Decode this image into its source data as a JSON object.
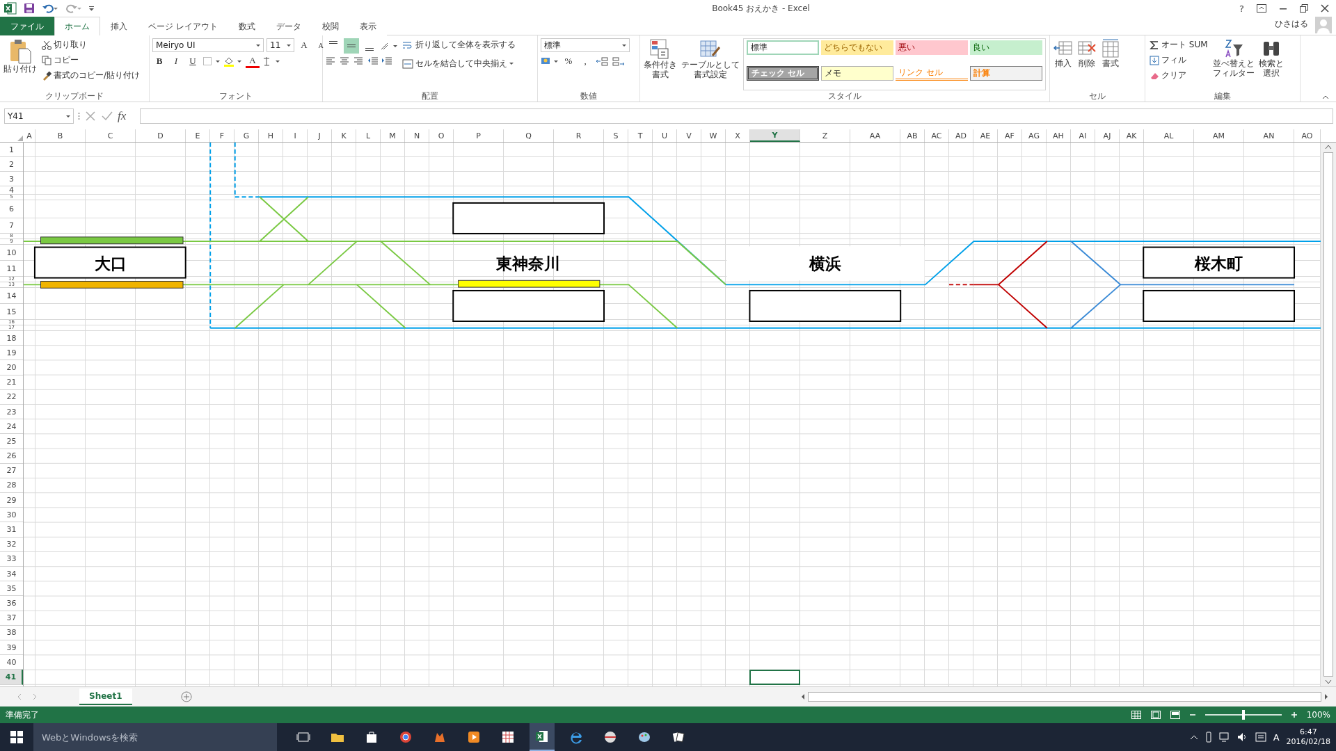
{
  "window": {
    "title": "Book45 おえかき - Excel",
    "help": "?",
    "user": "ひさはる"
  },
  "tabs": [
    {
      "label": "ファイル",
      "kind": "file",
      "selected": false
    },
    {
      "label": "ホーム",
      "kind": "tab",
      "selected": true
    },
    {
      "label": "挿入",
      "kind": "tab",
      "selected": false
    },
    {
      "label": "ページ レイアウト",
      "kind": "tab",
      "selected": false
    },
    {
      "label": "数式",
      "kind": "tab",
      "selected": false
    },
    {
      "label": "データ",
      "kind": "tab",
      "selected": false
    },
    {
      "label": "校閲",
      "kind": "tab",
      "selected": false
    },
    {
      "label": "表示",
      "kind": "tab",
      "selected": false
    }
  ],
  "clipboard": {
    "paste": "貼り付け",
    "cut": "切り取り",
    "copy": "コピー",
    "format_painter": "書式のコピー/貼り付け",
    "label": "クリップボード"
  },
  "font": {
    "name": "Meiryo UI",
    "size": "11",
    "grow": "A",
    "shrink": "A",
    "bold": "B",
    "italic": "I",
    "underline": "U",
    "font_color": "A",
    "label": "フォント"
  },
  "alignment": {
    "vertical": [
      {
        "selected": false
      },
      {
        "selected": true
      },
      {
        "selected": false
      }
    ],
    "wrap": "折り返して全体を表示する",
    "merge": "セルを結合して中央揃え",
    "label": "配置"
  },
  "number": {
    "format": "標準",
    "percent": "%",
    "comma": ",",
    "label": "数値"
  },
  "styles": {
    "conditional": [
      "条件付き",
      "書式"
    ],
    "table": [
      "テーブルとして",
      "書式設定"
    ],
    "cells": [
      {
        "label": "標準",
        "kind": "normal"
      },
      {
        "label": "どちらでもない",
        "kind": "neutral"
      },
      {
        "label": "悪い",
        "kind": "bad"
      },
      {
        "label": "良い",
        "kind": "good"
      },
      {
        "label": "チェック セル",
        "kind": "check"
      },
      {
        "label": "メモ",
        "kind": "note"
      },
      {
        "label": "リンク セル",
        "kind": "link"
      },
      {
        "label": "計算",
        "kind": "calc"
      }
    ],
    "label": "スタイル"
  },
  "cells": {
    "insert": "挿入",
    "delete": "削除",
    "format": "書式",
    "label": "セル"
  },
  "editing": {
    "autosum": "オート SUM",
    "fill": "フィル",
    "clear": "クリア",
    "sort": [
      "並べ替えと",
      "フィルター"
    ],
    "find": [
      "検索と",
      "選択"
    ],
    "label": "編集"
  },
  "formula_bar": {
    "name_box": "Y41",
    "fx": "fx"
  },
  "columns": [
    {
      "label": "A",
      "selected": false
    },
    {
      "label": "B",
      "selected": false
    },
    {
      "label": "C",
      "selected": false
    },
    {
      "label": "D",
      "selected": false
    },
    {
      "label": "E",
      "selected": false
    },
    {
      "label": "F",
      "selected": false
    },
    {
      "label": "G",
      "selected": false
    },
    {
      "label": "H",
      "selected": false
    },
    {
      "label": "I",
      "selected": false
    },
    {
      "label": "J",
      "selected": false
    },
    {
      "label": "K",
      "selected": false
    },
    {
      "label": "L",
      "selected": false
    },
    {
      "label": "M",
      "selected": false
    },
    {
      "label": "N",
      "selected": false
    },
    {
      "label": "O",
      "selected": false
    },
    {
      "label": "P",
      "selected": false
    },
    {
      "label": "Q",
      "selected": false
    },
    {
      "label": "R",
      "selected": false
    },
    {
      "label": "S",
      "selected": false
    },
    {
      "label": "T",
      "selected": false
    },
    {
      "label": "U",
      "selected": false
    },
    {
      "label": "V",
      "selected": false
    },
    {
      "label": "W",
      "selected": false
    },
    {
      "label": "X",
      "selected": false
    },
    {
      "label": "Y",
      "selected": true
    },
    {
      "label": "Z",
      "selected": false
    },
    {
      "label": "AA",
      "selected": false
    },
    {
      "label": "AB",
      "selected": false
    },
    {
      "label": "AC",
      "selected": false
    },
    {
      "label": "AD",
      "selected": false
    },
    {
      "label": "AE",
      "selected": false
    },
    {
      "label": "AF",
      "selected": false
    },
    {
      "label": "AG",
      "selected": false
    },
    {
      "label": "AH",
      "selected": false
    },
    {
      "label": "AI",
      "selected": false
    },
    {
      "label": "AJ",
      "selected": false
    },
    {
      "label": "AK",
      "selected": false
    },
    {
      "label": "AL",
      "selected": false
    },
    {
      "label": "AM",
      "selected": false
    },
    {
      "label": "AN",
      "selected": false
    },
    {
      "label": "AO",
      "selected": false
    }
  ],
  "rows": [
    {
      "label": "1",
      "selected": false
    },
    {
      "label": "2",
      "selected": false
    },
    {
      "label": "3",
      "selected": false
    },
    {
      "label": "4",
      "selected": false
    },
    {
      "label": "5",
      "selected": false
    },
    {
      "label": "6",
      "selected": false
    },
    {
      "label": "7",
      "selected": false
    },
    {
      "label": "8",
      "selected": false
    },
    {
      "label": "9",
      "selected": false
    },
    {
      "label": "10",
      "selected": false
    },
    {
      "label": "11",
      "selected": false
    },
    {
      "label": "12",
      "selected": false
    },
    {
      "label": "13",
      "selected": false
    },
    {
      "label": "14",
      "selected": false
    },
    {
      "label": "15",
      "selected": false
    },
    {
      "label": "16",
      "selected": false
    },
    {
      "label": "17",
      "selected": false
    },
    {
      "label": "18",
      "selected": false
    },
    {
      "label": "19",
      "selected": false
    },
    {
      "label": "20",
      "selected": false
    },
    {
      "label": "21",
      "selected": false
    },
    {
      "label": "22",
      "selected": false
    },
    {
      "label": "23",
      "selected": false
    },
    {
      "label": "24",
      "selected": false
    },
    {
      "label": "25",
      "selected": false
    },
    {
      "label": "26",
      "selected": false
    },
    {
      "label": "27",
      "selected": false
    },
    {
      "label": "28",
      "selected": false
    },
    {
      "label": "29",
      "selected": false
    },
    {
      "label": "30",
      "selected": false
    },
    {
      "label": "31",
      "selected": false
    },
    {
      "label": "32",
      "selected": false
    },
    {
      "label": "33",
      "selected": false
    },
    {
      "label": "34",
      "selected": false
    },
    {
      "label": "35",
      "selected": false
    },
    {
      "label": "36",
      "selected": false
    },
    {
      "label": "37",
      "selected": false
    },
    {
      "label": "38",
      "selected": false
    },
    {
      "label": "39",
      "selected": false
    },
    {
      "label": "40",
      "selected": false
    },
    {
      "label": "41",
      "selected": true
    }
  ],
  "stations": [
    {
      "name": "大口"
    },
    {
      "name": "東神奈川"
    },
    {
      "name": "横浜"
    },
    {
      "name": "桜木町"
    }
  ],
  "sheet_tabs": [
    {
      "label": "Sheet1",
      "selected": true
    }
  ],
  "status_bar": {
    "text": "準備完了",
    "zoom": "100%",
    "zoom_slider": {
      "level": 0.5
    }
  },
  "taskbar": {
    "search_placeholder": "WebとWindowsを検索",
    "ime": "A",
    "time": "6:47",
    "date": "2016/02/18"
  }
}
